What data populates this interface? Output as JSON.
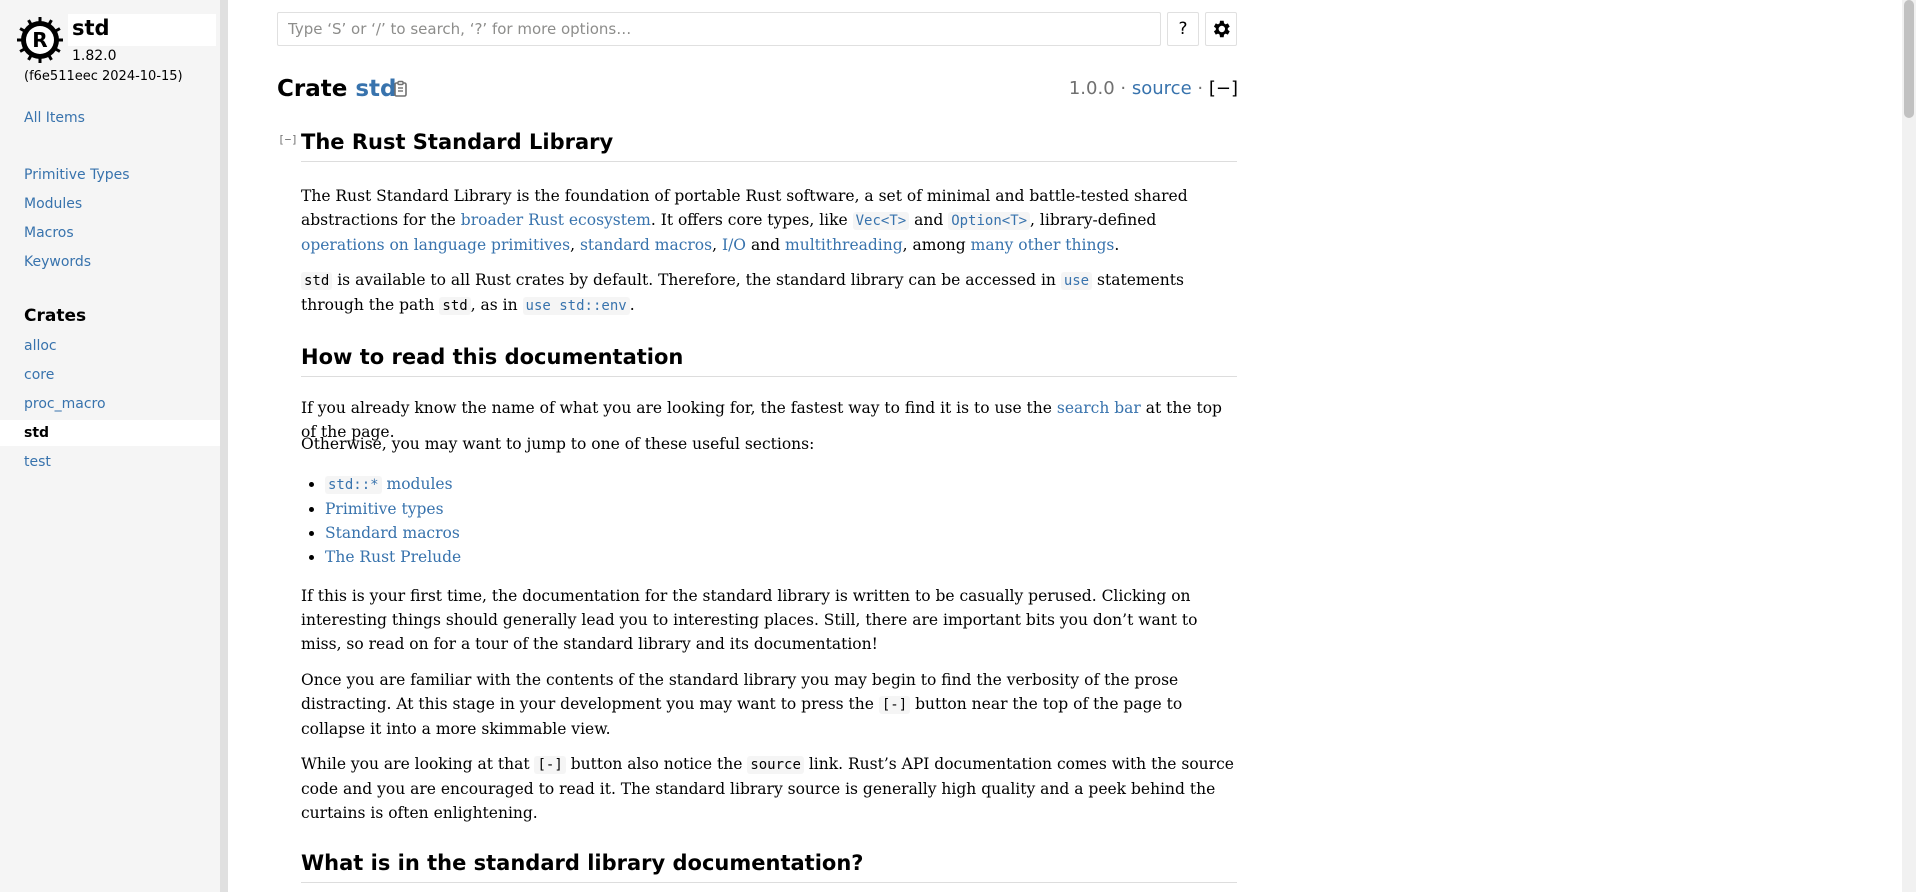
{
  "sidebar": {
    "crate_name": "std",
    "version": "1.82.0",
    "hash": "(f6e511eec 2024-10-15)",
    "all_items": "All Items",
    "sections": [
      "Primitive Types",
      "Modules",
      "Macros",
      "Keywords"
    ],
    "crates_heading": "Crates",
    "crates": [
      "alloc",
      "core",
      "proc_macro",
      "std",
      "test"
    ]
  },
  "search": {
    "placeholder": "Type ‘S’ or ‘/’ to search, ‘?’ for more options…",
    "help_label": "?"
  },
  "header": {
    "kind": "Crate",
    "name": "std",
    "version": "1.0.0",
    "sep": "·",
    "source": "source",
    "collapse": "[−]"
  },
  "content": {
    "toggle": "[−]",
    "h1": "The Rust Standard Library",
    "p1": {
      "t1": "The Rust Standard Library is the foundation of portable Rust software, a set of minimal and battle-tested shared abstractions for the ",
      "l1": "broader Rust ecosystem",
      "t2": ". It offers core types, like ",
      "c1": "Vec<T>",
      "t3": " and ",
      "c2": "Option<T>",
      "t4": ", library-defined ",
      "l2": "operations on language primitives",
      "t5": ", ",
      "l3": "standard macros",
      "t6": ", ",
      "l4": "I/O",
      "t7": " and ",
      "l5": "multithreading",
      "t8": ", among ",
      "l6": "many other things",
      "t9": "."
    },
    "p2": {
      "c1": "std",
      "t1": " is available to all Rust crates by default. Therefore, the standard library can be accessed in ",
      "c2": "use",
      "t2": " statements through the path ",
      "c3": "std",
      "t3": ", as in ",
      "c4": "use std::env",
      "t4": "."
    },
    "h2": "How to read this documentation",
    "p3": {
      "t1": "If you already know the name of what you are looking for, the fastest way to find it is to use the ",
      "l1": "search bar",
      "t2": " at the top of the page."
    },
    "p4": "Otherwise, you may want to jump to one of these useful sections:",
    "list": {
      "i1_code": "std::*",
      "i1_text": " modules",
      "i2": "Primitive types",
      "i3": "Standard macros",
      "i4": "The Rust Prelude"
    },
    "p5": "If this is your first time, the documentation for the standard library is written to be casually perused. Clicking on interesting things should generally lead you to interesting places. Still, there are important bits you don’t want to miss, so read on for a tour of the standard library and its documentation!",
    "p6": {
      "t1": "Once you are familiar with the contents of the standard library you may begin to find the verbosity of the prose distracting. At this stage in your development you may want to press the ",
      "c1": "[-]",
      "t2": " button near the top of the page to collapse it into a more skimmable view."
    },
    "p7": {
      "t1": "While you are looking at that ",
      "c1": "[-]",
      "t2": " button also notice the ",
      "c2": "source",
      "t3": " link. Rust’s API documentation comes with the source code and you are encouraged to read it. The standard library source is generally high quality and a peek behind the curtains is often enlightening."
    },
    "h3": "What is in the standard library documentation?"
  }
}
